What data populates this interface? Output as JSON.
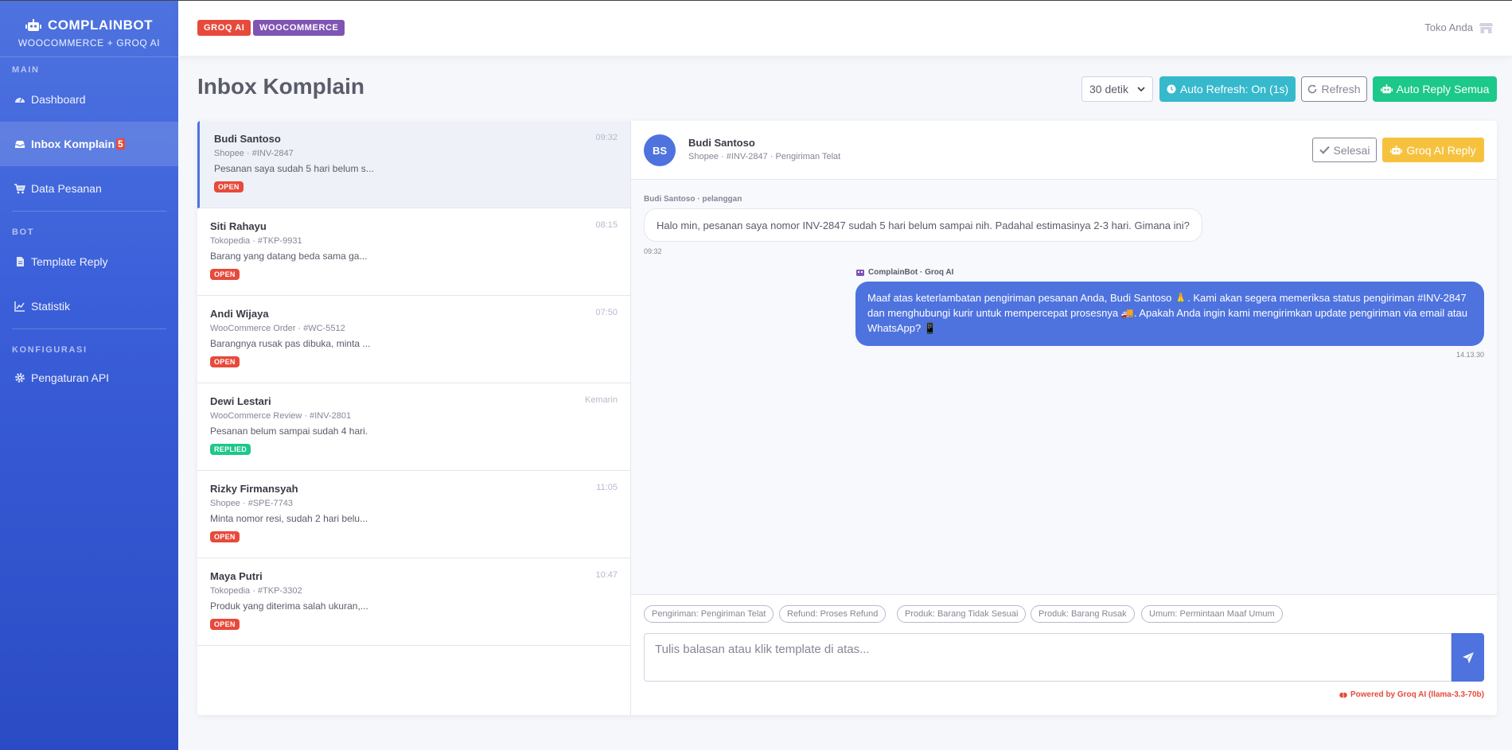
{
  "brand": {
    "title": "COMPLAINBOT",
    "subtitle": "WOOCOMMERCE + GROQ AI"
  },
  "sidebar": {
    "sections": [
      {
        "heading": "MAIN"
      },
      {
        "heading": "BOT"
      },
      {
        "heading": "KONFIGURASI"
      }
    ],
    "items": [
      {
        "label": "Dashboard",
        "icon": "dashboard-icon"
      },
      {
        "label": "Inbox Komplain",
        "badge": "5",
        "icon": "inbox-icon"
      },
      {
        "label": "Data Pesanan",
        "icon": "cart-icon"
      },
      {
        "label": "Template Reply",
        "icon": "file-icon"
      },
      {
        "label": "Statistik",
        "icon": "chart-icon"
      },
      {
        "label": "Pengaturan API",
        "icon": "gear-icon"
      }
    ]
  },
  "topbar": {
    "badges": [
      {
        "label": "GROQ AI",
        "color": "#e74a3b"
      },
      {
        "label": "WOOCOMMERCE",
        "color": "#7f54b3"
      }
    ],
    "store_name": "Toko Anda"
  },
  "header": {
    "title": "Inbox Komplain",
    "interval": "30 detik",
    "auto_refresh": "Auto Refresh: On (1s)",
    "refresh": "Refresh",
    "auto_reply": "Auto Reply Semua"
  },
  "conversations": [
    {
      "name": "Budi Santoso",
      "meta": "Shopee · #INV-2847",
      "preview": "Pesanan saya sudah 5 hari belum s...",
      "time": "09:32",
      "status": "OPEN"
    },
    {
      "name": "Siti Rahayu",
      "meta": "Tokopedia · #TKP-9931",
      "preview": "Barang yang datang beda sama ga...",
      "time": "08:15",
      "status": "OPEN"
    },
    {
      "name": "Andi Wijaya",
      "meta": "WooCommerce Order · #WC-5512",
      "preview": "Barangnya rusak pas dibuka, minta ...",
      "time": "07:50",
      "status": "OPEN"
    },
    {
      "name": "Dewi Lestari",
      "meta": "WooCommerce Review · #INV-2801",
      "preview": "Pesanan belum sampai sudah 4 hari.",
      "time": "Kemarin",
      "status": "REPLIED"
    },
    {
      "name": "Rizky Firmansyah",
      "meta": "Shopee · #SPE-7743",
      "preview": "Minta nomor resi, sudah 2 hari belu...",
      "time": "11:05",
      "status": "OPEN"
    },
    {
      "name": "Maya Putri",
      "meta": "Tokopedia · #TKP-3302",
      "preview": "Produk yang diterima salah ukuran,...",
      "time": "10:47",
      "status": "OPEN"
    }
  ],
  "chat": {
    "initials": "BS",
    "name": "Budi Santoso",
    "meta": "Shopee · #INV-2847 · Pengiriman Telat",
    "done_label": "Selesai",
    "groq_label": "Groq AI Reply",
    "incoming": {
      "sender": "Budi Santoso · pelanggan",
      "text": "Halo min, pesanan saya nomor INV-2847 sudah 5 hari belum sampai nih. Padahal estimasinya 2-3 hari. Gimana ini?",
      "time": "09:32"
    },
    "outgoing": {
      "sender": "ComplainBot · Groq AI",
      "text": "Maaf atas keterlambatan pengiriman pesanan Anda, Budi Santoso 🙏. Kami akan segera memeriksa status pengiriman #INV-2847 dan menghubungi kurir untuk mempercepat prosesnya 🚚. Apakah Anda ingin kami mengirimkan update pengiriman via email atau WhatsApp? 📱",
      "time": "14.13.30"
    }
  },
  "composer": {
    "templates": [
      "Pengiriman: Pengiriman Telat",
      "Refund: Proses Refund",
      "Produk: Barang Tidak Sesuai",
      "Produk: Barang Rusak",
      "Umum: Permintaan Maaf Umum"
    ],
    "placeholder": "Tulis balasan atau klik template di atas...",
    "powered": "Powered by Groq AI (llama-3.3-70b)"
  }
}
